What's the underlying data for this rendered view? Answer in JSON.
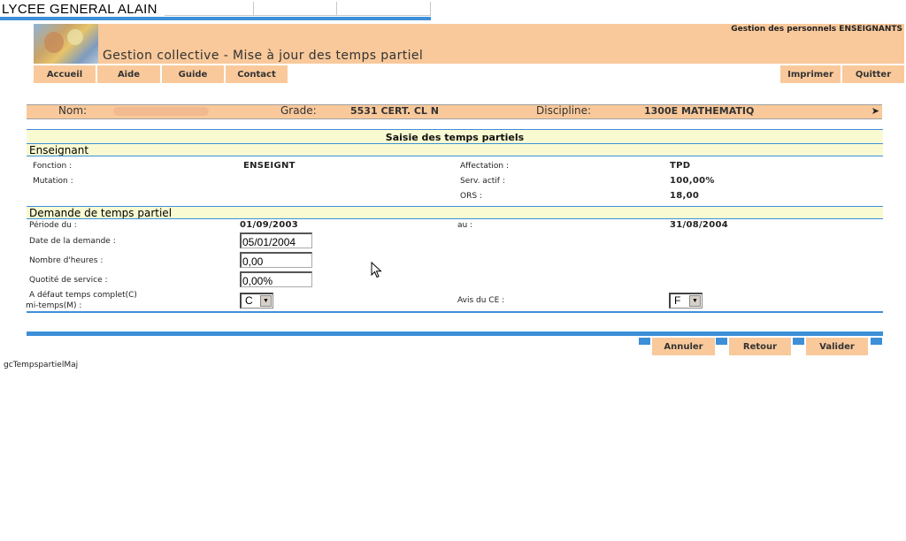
{
  "school": {
    "name": "LYCEE GENERAL ALAIN"
  },
  "header": {
    "subtitle": "Gestion des personnels ENSEIGNANTS",
    "title": "Gestion collective - Mise à jour des temps partiel"
  },
  "nav": {
    "accueil": "Accueil",
    "aide": "Aide",
    "guide": "Guide",
    "contact": "Contact",
    "imprimer": "Imprimer",
    "quitter": "Quitter"
  },
  "info": {
    "nom_label": "Nom:",
    "grade_label": "Grade:",
    "grade_value": "5531 CERT. CL N",
    "discipline_label": "Discipline:",
    "discipline_value": "1300E MATHEMATIQ",
    "arrow": "➤"
  },
  "section_title": "Saisie des temps partiels",
  "enseignant": {
    "heading": "Enseignant",
    "fonction_label": "Fonction :",
    "fonction_value": "ENSEIGNT",
    "mutation_label": "Mutation :",
    "affectation_label": "Affectation :",
    "affectation_value": "TPD",
    "serv_actif_label": "Serv. actif :",
    "serv_actif_value": "100,00%",
    "ors_label": "ORS :",
    "ors_value": "18,00"
  },
  "demande": {
    "heading": "Demande de temps partiel",
    "periode_label": "Période du :",
    "periode_du": "01/09/2003",
    "au_label": "au :",
    "periode_au": "31/08/2004",
    "date_demande_label": "Date de la demande :",
    "date_demande_value": "05/01/2004",
    "nb_heures_label": "Nombre d'heures :",
    "nb_heures_value": "0,00",
    "quotite_label": "Quotité de service :",
    "quotite_value": "0,00%",
    "defaut_label_1": "A défaut temps complet(C)",
    "defaut_label_2": "mi-temps(M) :",
    "defaut_value": "C",
    "avis_label": "Avis du CE :",
    "avis_value": "F"
  },
  "actions": {
    "annuler": "Annuler",
    "retour": "Retour",
    "valider": "Valider"
  },
  "footer": {
    "screen_id": "gcTempspartielMaj"
  },
  "colors": {
    "accent_blue": "#3d8fd8",
    "peach": "#f9c99b",
    "pale_yellow": "#fafad2"
  }
}
